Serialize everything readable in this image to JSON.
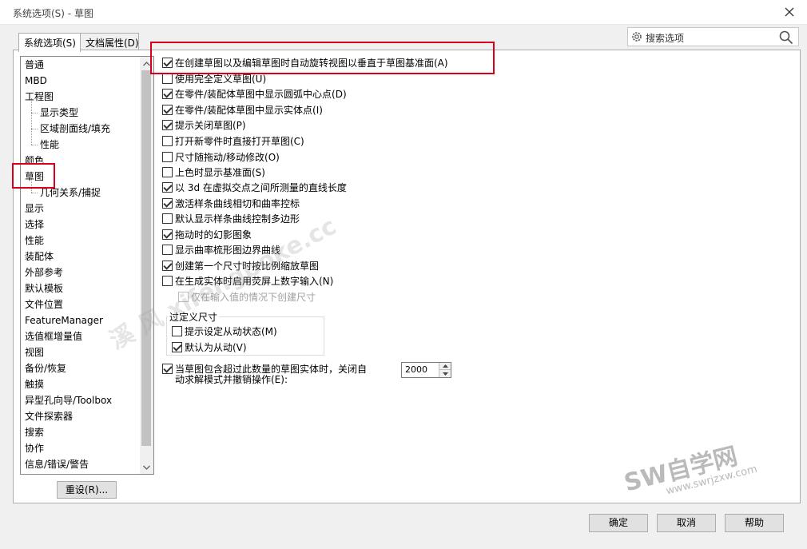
{
  "window": {
    "title": "系统选项(S) - 草图"
  },
  "tabs": [
    {
      "label": "系统选项(S)"
    },
    {
      "label": "文档属性(D)"
    }
  ],
  "search": {
    "placeholder": "搜索选项"
  },
  "tree": {
    "items": [
      {
        "label": "普通"
      },
      {
        "label": "MBD"
      },
      {
        "label": "工程图"
      },
      {
        "label": "显示类型"
      },
      {
        "label": "区域剖面线/填充"
      },
      {
        "label": "性能"
      },
      {
        "label": "颜色"
      },
      {
        "label": "草图"
      },
      {
        "label": "几何关系/捕捉"
      },
      {
        "label": "显示"
      },
      {
        "label": "选择"
      },
      {
        "label": "性能"
      },
      {
        "label": "装配体"
      },
      {
        "label": "外部参考"
      },
      {
        "label": "默认模板"
      },
      {
        "label": "文件位置"
      },
      {
        "label": "FeatureManager"
      },
      {
        "label": "选值框增量值"
      },
      {
        "label": "视图"
      },
      {
        "label": "备份/恢复"
      },
      {
        "label": "触摸"
      },
      {
        "label": "异型孔向导/Toolbox"
      },
      {
        "label": "文件探索器"
      },
      {
        "label": "搜索"
      },
      {
        "label": "协作"
      },
      {
        "label": "信息/错误/警告"
      }
    ]
  },
  "reset_button": "重设(R)...",
  "options": [
    {
      "label": "在创建草图以及编辑草图时自动旋转视图以垂直于草图基准面(A)",
      "checked": true
    },
    {
      "label": "使用完全定义草图(U)",
      "checked": false
    },
    {
      "label": "在零件/装配体草图中显示圆弧中心点(D)",
      "checked": true
    },
    {
      "label": "在零件/装配体草图中显示实体点(I)",
      "checked": true
    },
    {
      "label": "提示关闭草图(P)",
      "checked": true
    },
    {
      "label": "打开新零件时直接打开草图(C)",
      "checked": false
    },
    {
      "label": "尺寸随拖动/移动修改(O)",
      "checked": false
    },
    {
      "label": "上色时显示基准面(S)",
      "checked": false
    },
    {
      "label": "以 3d 在虚拟交点之间所测量的直线长度",
      "checked": true
    },
    {
      "label": "激活样条曲线相切和曲率控标",
      "checked": true
    },
    {
      "label": "默认显示样条曲线控制多边形",
      "checked": false
    },
    {
      "label": "拖动时的幻影图象",
      "checked": true
    },
    {
      "label": "显示曲率梳形图边界曲线",
      "checked": false
    },
    {
      "label": "创建第一个尺寸时按比例缩放草图",
      "checked": true
    },
    {
      "label": "在生成实体时启用荧屏上数字输入(N)",
      "checked": false
    },
    {
      "label": "仅在输入值的情况下创建尺寸",
      "checked": false,
      "disabled": true
    }
  ],
  "overdefined": {
    "title": "过定义尺寸",
    "options": [
      {
        "label": "提示设定从动状态(M)",
        "checked": false
      },
      {
        "label": "默认为从动(V)",
        "checked": true
      }
    ]
  },
  "solver": {
    "label_line1": "当草图包含超过此数量的草图实体时，关闭自",
    "label_line2": "动求解模式并撤销操作(E):",
    "checked": true,
    "value": "2000"
  },
  "footer": {
    "ok": "确定",
    "cancel": "取消",
    "help": "帮助"
  },
  "watermarks": {
    "diagonal": "溪 风 xifengboke.cc",
    "logo_big": "SW自学网",
    "logo_small": "www.swrjzxw.com"
  },
  "colors": {
    "highlight_box": "#d9001b",
    "panel_bg": "#ffffff",
    "window_bg": "#f0f0f0"
  }
}
